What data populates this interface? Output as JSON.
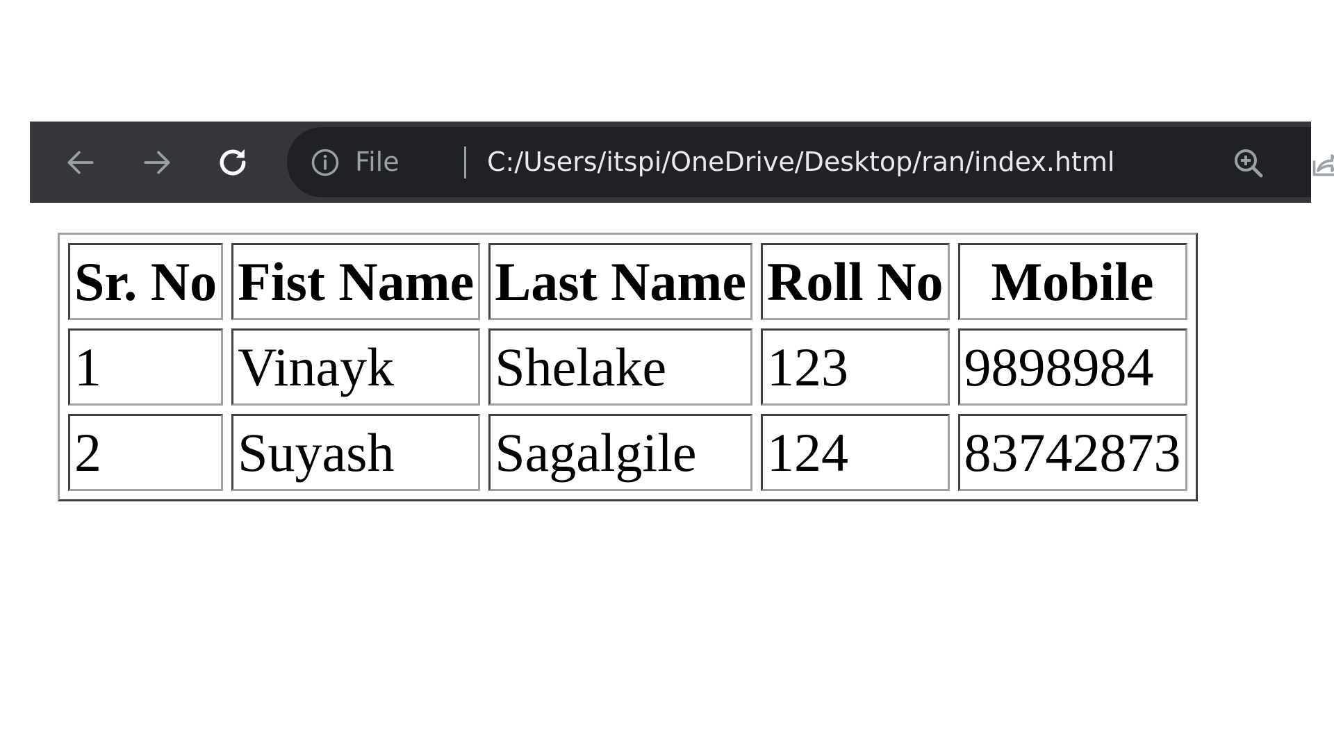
{
  "browser": {
    "file_label": "File",
    "url": "C:/Users/itspi/OneDrive/Desktop/ran/index.html",
    "icons": [
      "back-arrow-icon",
      "forward-arrow-icon",
      "reload-icon",
      "info-icon",
      "zoom-icon",
      "share-icon"
    ],
    "toolbar_color": "#35363a",
    "omnibox_color": "#202124"
  },
  "table": {
    "headers": [
      "Sr. No",
      "Fist Name",
      "Last Name",
      "Roll No",
      "Mobile"
    ],
    "rows": [
      [
        "1",
        "Vinayk",
        "Shelake",
        "123",
        "9898984"
      ],
      [
        "2",
        "Suyash",
        "Sagalgile",
        "124",
        "83742873"
      ]
    ]
  }
}
